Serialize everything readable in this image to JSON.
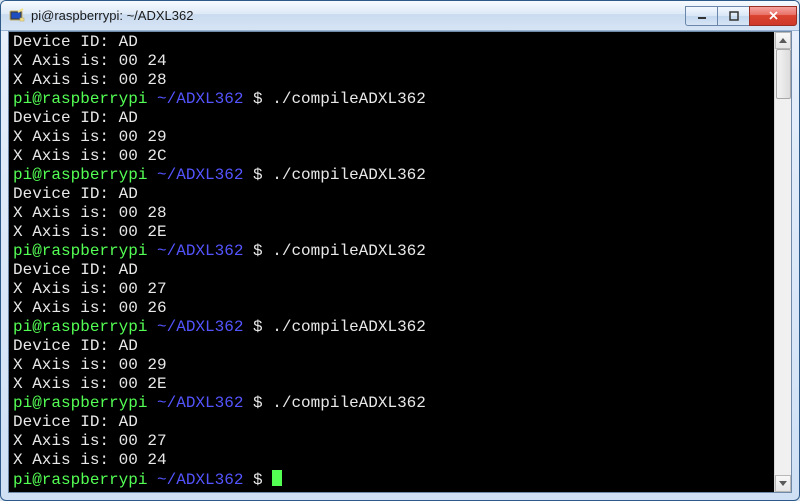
{
  "window": {
    "title": "pi@raspberrypi: ~/ADXL362"
  },
  "prompt": {
    "user_host": "pi@raspberrypi",
    "path": "~/ADXL362",
    "symbol": "$"
  },
  "command": "./compileADXL362",
  "blocks": [
    {
      "device_id": "AD",
      "x1": "00 24",
      "x2": "00 28",
      "leading_prompt": false
    },
    {
      "device_id": "AD",
      "x1": "00 29",
      "x2": "00 2C",
      "leading_prompt": true
    },
    {
      "device_id": "AD",
      "x1": "00 28",
      "x2": "00 2E",
      "leading_prompt": true
    },
    {
      "device_id": "AD",
      "x1": "00 27",
      "x2": "00 26",
      "leading_prompt": true
    },
    {
      "device_id": "AD",
      "x1": "00 29",
      "x2": "00 2E",
      "leading_prompt": true
    },
    {
      "device_id": "AD",
      "x1": "00 27",
      "x2": "00 24",
      "leading_prompt": true
    }
  ],
  "labels": {
    "device_id": "Device ID:",
    "x_axis": "X Axis is:"
  }
}
